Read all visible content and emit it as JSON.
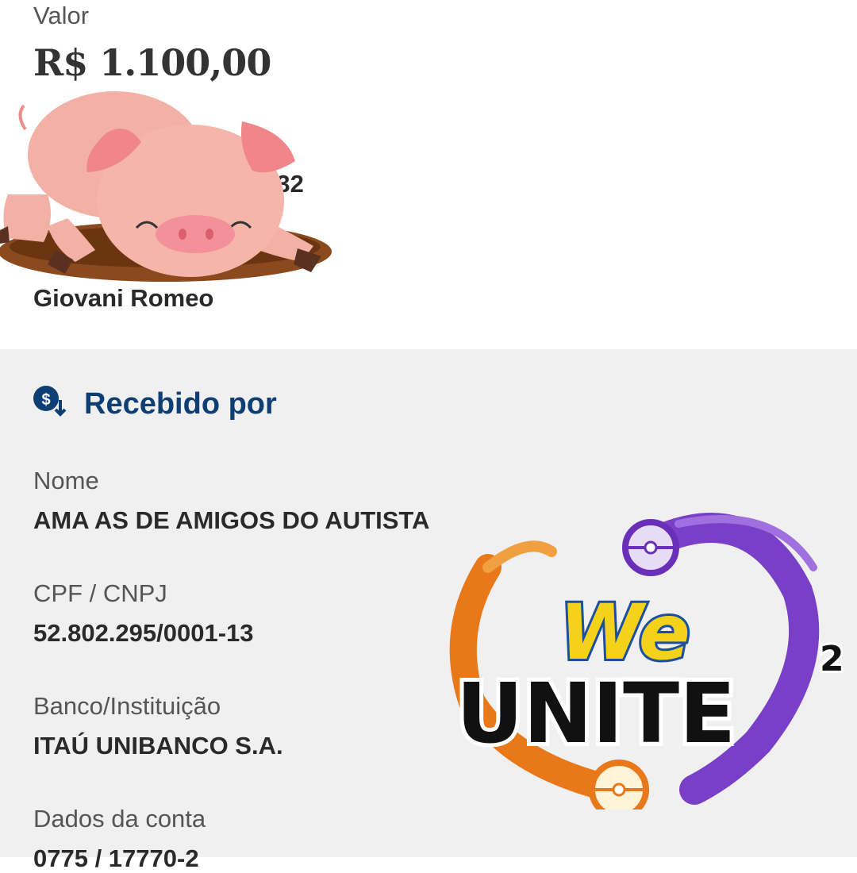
{
  "receipt": {
    "amount_label": "Valor",
    "amount": "R$ 1.100,00",
    "time_fragment": ":32",
    "sender_name": "Giovani Romeo"
  },
  "received_by": {
    "title": "Recebido por",
    "icon": "money-transfer-icon",
    "fields": [
      {
        "label": "Nome",
        "value": "AMA AS  DE AMIGOS DO AUTISTA"
      },
      {
        "label": "CPF / CNPJ",
        "value": "52.802.295/0001-13"
      },
      {
        "label": "Banco/Instituição",
        "value": "ITAÚ UNIBANCO S.A."
      },
      {
        "label": "Dados da conta",
        "value": "0775 / 17770-2"
      }
    ]
  },
  "overlay": {
    "logo_word_top": "We",
    "logo_word_main": "UNITE",
    "logo_superscript": "2"
  },
  "colors": {
    "accent_blue": "#0d3f75",
    "section_bg": "#f0f0f0",
    "pig_pink": "#f3a9a0",
    "logo_orange": "#e8781a",
    "logo_purple": "#7a3fc8",
    "logo_yellow": "#f5d21a"
  }
}
